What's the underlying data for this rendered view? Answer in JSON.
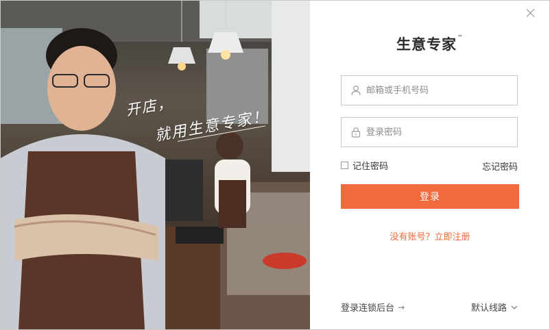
{
  "photo": {
    "slogan_line1": "开店，",
    "slogan_line2": "就用生意专家！"
  },
  "header": {
    "brand": "生意专家",
    "trademark": "™"
  },
  "form": {
    "username": {
      "placeholder": "邮箱或手机号码",
      "value": ""
    },
    "password": {
      "placeholder": "登录密码",
      "value": ""
    },
    "remember_label": "记住密码",
    "remember_checked": false,
    "forgot_label": "忘记密码",
    "login_label": "登录",
    "register_label": "没有账号？立即注册"
  },
  "footer": {
    "chain_backend_label": "登录连锁后台",
    "line_select_label": "默认线路"
  },
  "colors": {
    "accent": "#f26a3c",
    "link": "#ee6a3d",
    "text": "#333333"
  },
  "icons": [
    "close-icon",
    "user-icon",
    "lock-icon",
    "arrow-right-icon",
    "chevron-down-icon"
  ]
}
